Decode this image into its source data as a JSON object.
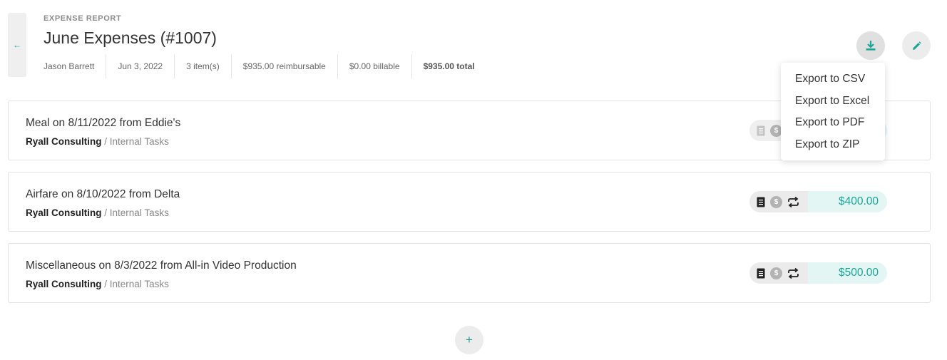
{
  "back": {
    "glyph": "←"
  },
  "header": {
    "eyebrow": "EXPENSE REPORT",
    "title": "June Expenses (#1007)",
    "meta": {
      "owner": "Jason Barrett",
      "date": "Jun 3, 2022",
      "items": "3 item(s)",
      "reimbursable": "$935.00 reimbursable",
      "billable": "$0.00 billable",
      "total": "$935.00 total"
    }
  },
  "actions": {
    "download_icon": "download-icon",
    "edit_icon": "pencil-icon",
    "accent": "#1aa597"
  },
  "export_menu": [
    "Export to CSV",
    "Export to Excel",
    "Export to PDF",
    "Export to ZIP"
  ],
  "expenses": [
    {
      "title": "Meal on 8/11/2022 from Eddie's",
      "client": "Ryall Consulting",
      "project": "Internal Tasks",
      "amount": ""
    },
    {
      "title": "Airfare on 8/10/2022 from Delta",
      "client": "Ryall Consulting",
      "project": "Internal Tasks",
      "amount": "$400.00"
    },
    {
      "title": "Miscellaneous on 8/3/2022 from All-in Video Production",
      "client": "Ryall Consulting",
      "project": "Internal Tasks",
      "amount": "$500.00"
    }
  ],
  "add": {
    "glyph": "+"
  }
}
